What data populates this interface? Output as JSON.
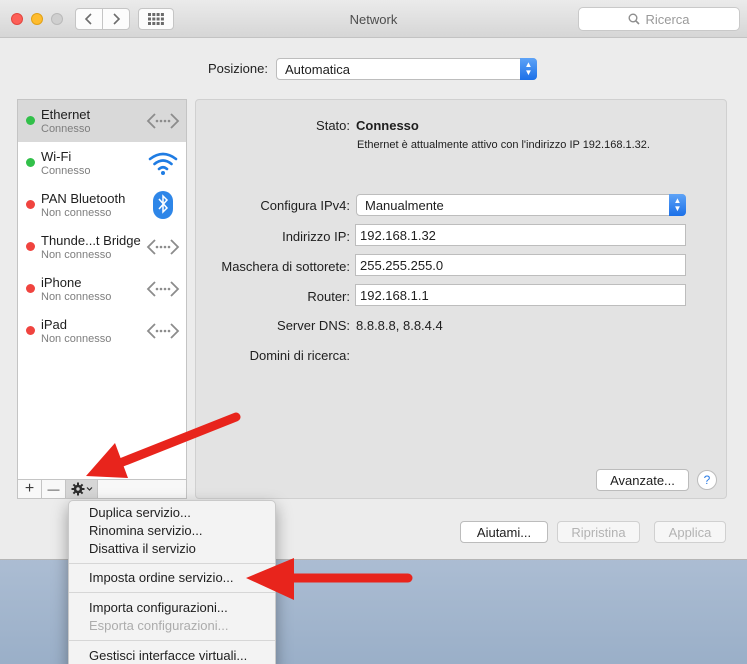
{
  "window": {
    "title": "Network"
  },
  "search": {
    "placeholder": "Ricerca"
  },
  "location": {
    "label": "Posizione:",
    "value": "Automatica"
  },
  "services": [
    {
      "name": "Ethernet",
      "status": "Connesso",
      "state": "green",
      "icon": "ethernet-icon",
      "selected": true
    },
    {
      "name": "Wi-Fi",
      "status": "Connesso",
      "state": "green",
      "icon": "wifi-icon"
    },
    {
      "name": "PAN Bluetooth",
      "status": "Non connesso",
      "state": "red",
      "icon": "bluetooth-icon"
    },
    {
      "name": "Thunde...t Bridge",
      "status": "Non connesso",
      "state": "red",
      "icon": "thunderbolt-bridge-icon"
    },
    {
      "name": "iPhone",
      "status": "Non connesso",
      "state": "red",
      "icon": "iphone-network-icon"
    },
    {
      "name": "iPad",
      "status": "Non connesso",
      "state": "red",
      "icon": "ipad-network-icon"
    }
  ],
  "toolbar": {
    "add": "+",
    "remove": "—",
    "gear": "gear-icon"
  },
  "detail": {
    "status_label": "Stato:",
    "status_value": "Connesso",
    "status_desc": "Ethernet è attualmente attivo con l'indirizzo IP 192.168.1.32.",
    "ipv4_label": "Configura IPv4:",
    "ipv4_value": "Manualmente",
    "ip_label": "Indirizzo IP:",
    "ip_value": "192.168.1.32",
    "mask_label": "Maschera di sottorete:",
    "mask_value": "255.255.255.0",
    "router_label": "Router:",
    "router_value": "192.168.1.1",
    "dns_label": "Server DNS:",
    "dns_value": "8.8.8.8, 8.8.4.4",
    "domains_label": "Domini di ricerca:",
    "advanced": "Avanzate...",
    "help": "?"
  },
  "footer": {
    "help": "Aiutami...",
    "revert": "Ripristina",
    "apply": "Applica"
  },
  "menu": {
    "duplicate": "Duplica servizio...",
    "rename": "Rinomina servizio...",
    "disable": "Disattiva il servizio",
    "order": "Imposta ordine servizio...",
    "import": "Importa configurazioni...",
    "export": "Esporta configurazioni...",
    "virtual": "Gestisci interfacce virtuali..."
  },
  "colors": {
    "annotation_arrow": "#e8241c",
    "accent": "#1b70e8",
    "connected": "#32c04a",
    "disconnected": "#f0443f"
  }
}
